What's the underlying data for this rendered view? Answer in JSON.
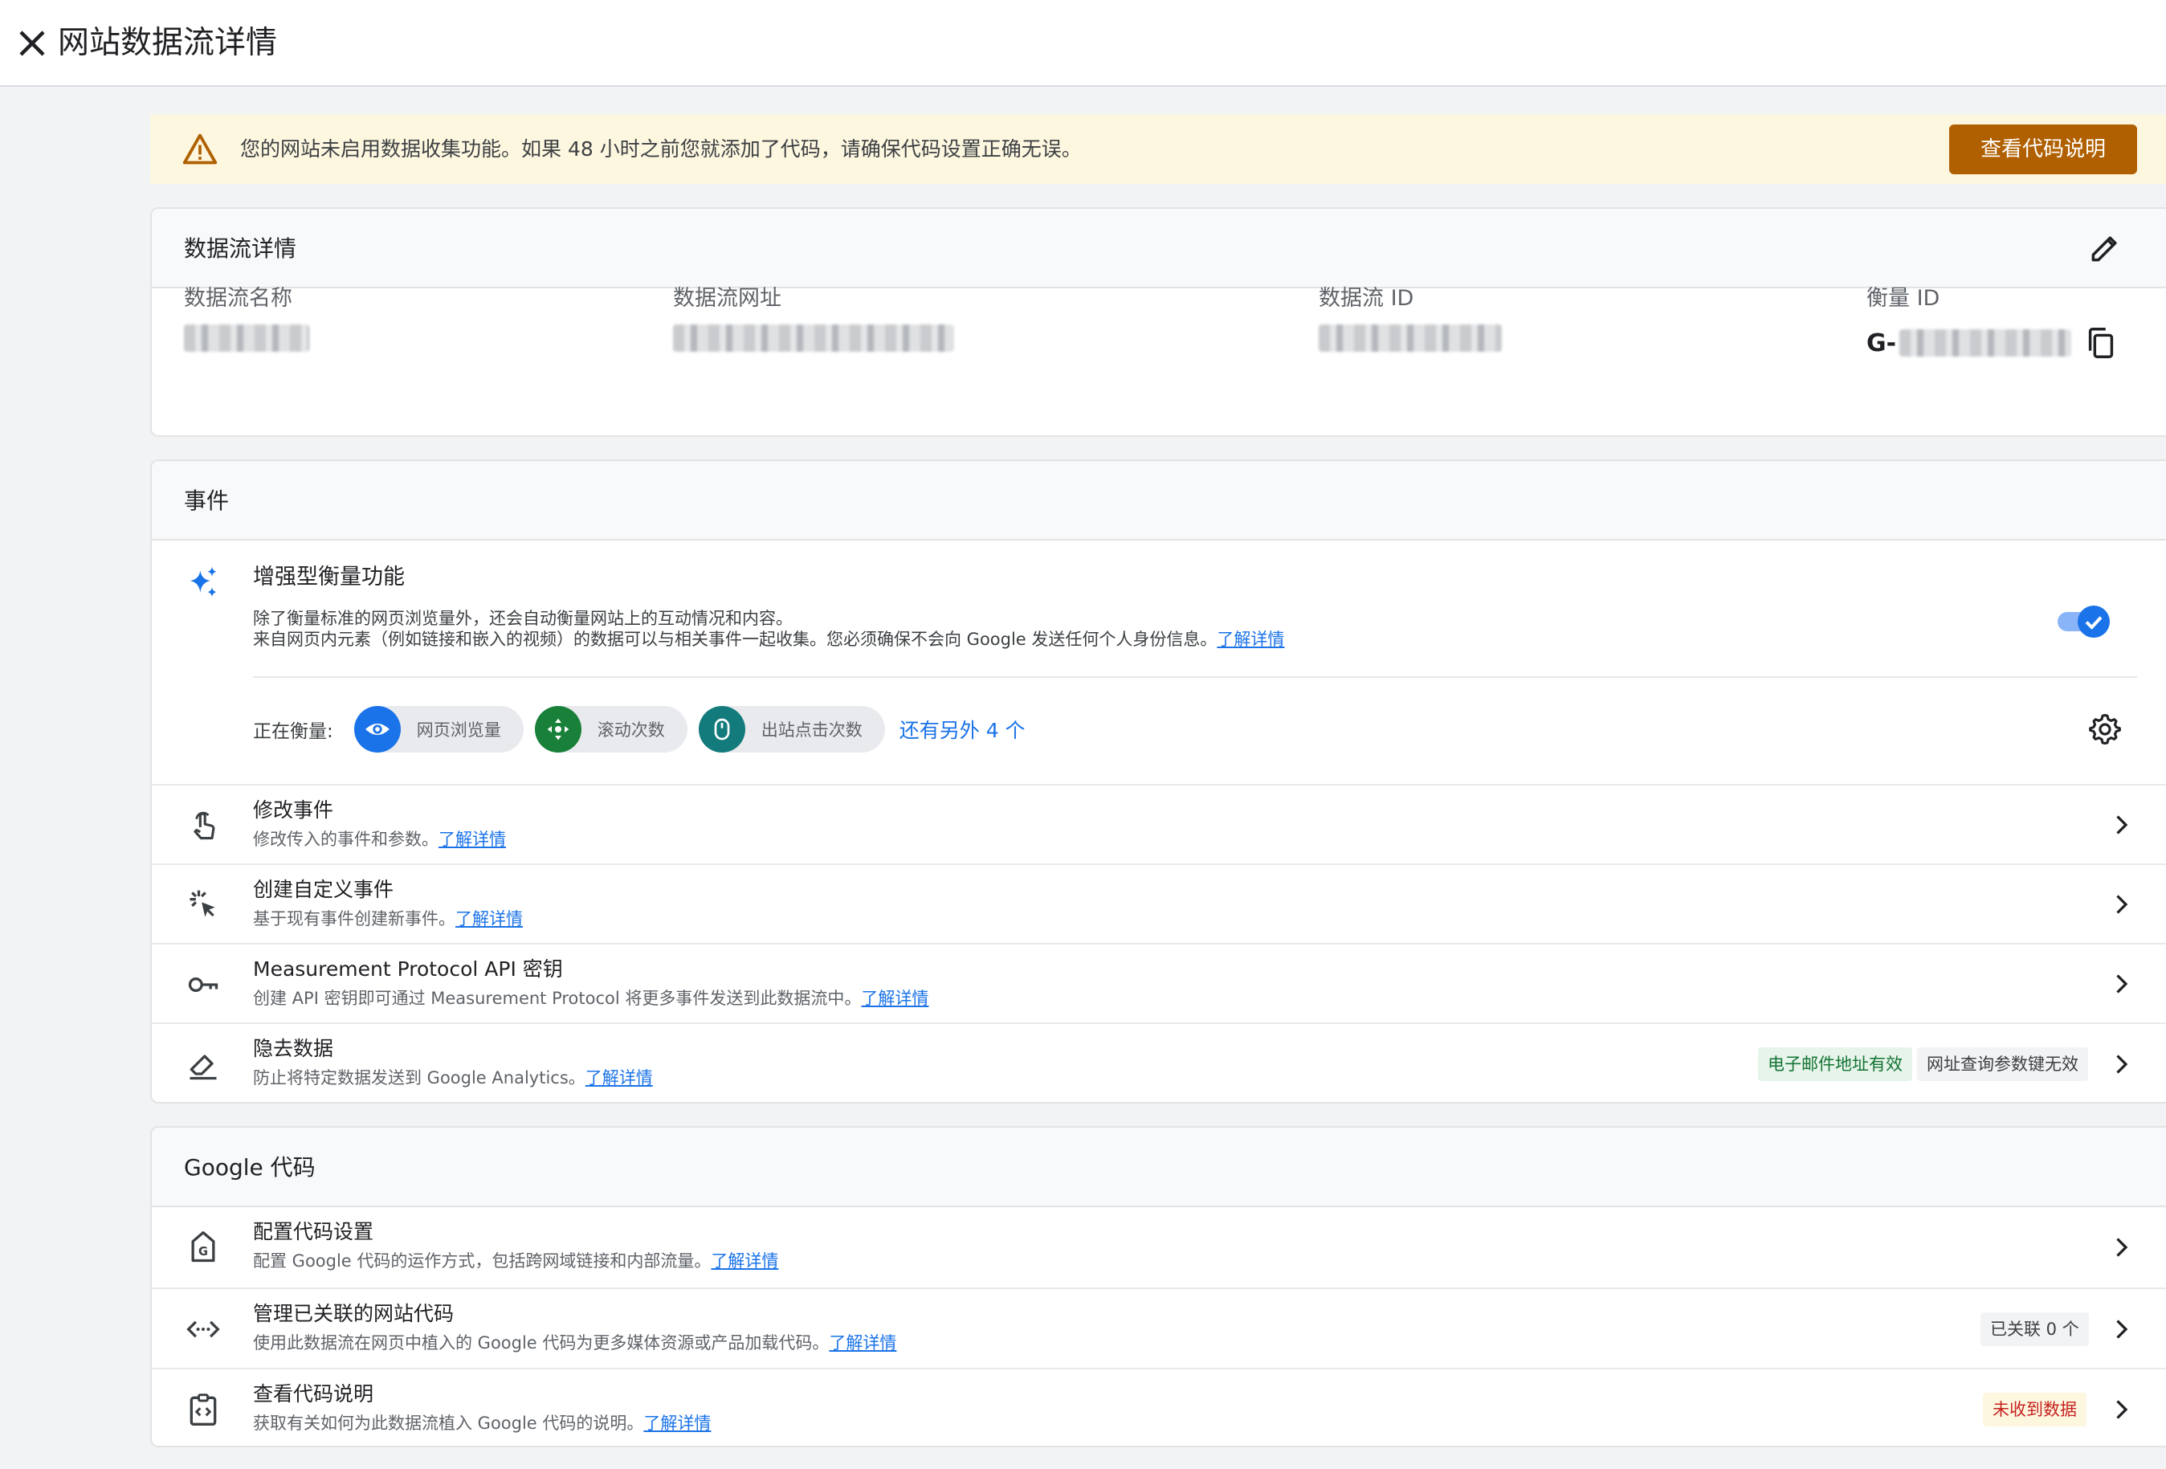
{
  "page": {
    "title": "网站数据流详情"
  },
  "banner": {
    "message": "您的网站未启用数据收集功能。如果 48 小时之前您就添加了代码，请确保代码设置正确无误。",
    "button_label": "查看代码说明"
  },
  "stream_details": {
    "title": "数据流详情",
    "fields": {
      "name_label": "数据流名称",
      "url_label": "数据流网址",
      "id_label": "数据流 ID",
      "measurement_label": "衡量 ID",
      "measurement_prefix": "G-"
    }
  },
  "events": {
    "title": "事件",
    "enhanced": {
      "title": "增强型衡量功能",
      "desc_line1": "除了衡量标准的网页浏览量外，还会自动衡量网站上的互动情况和内容。",
      "desc_line2": "来自网页内元素（例如链接和嵌入的视频）的数据可以与相关事件一起收集。您必须确保不会向 Google 发送任何个人身份信息。",
      "learn_more": "了解详情",
      "enabled": true,
      "measuring_label": "正在衡量:",
      "chips": [
        {
          "label": "网页浏览量",
          "icon": "eye-icon",
          "color": "#1a73e8"
        },
        {
          "label": "滚动次数",
          "icon": "scroll-icon",
          "color": "#188038"
        },
        {
          "label": "出站点击次数",
          "icon": "mouse-icon",
          "color": "#137b7c"
        }
      ],
      "more_link": "还有另外 4 个"
    },
    "rows": [
      {
        "title": "修改事件",
        "desc": "修改传入的事件和参数。",
        "link": "了解详情",
        "icon": "touch-icon"
      },
      {
        "title": "创建自定义事件",
        "desc": "基于现有事件创建新事件。",
        "link": "了解详情",
        "icon": "click-sparkle-icon"
      },
      {
        "title": "Measurement Protocol API 密钥",
        "desc": "创建 API 密钥即可通过 Measurement Protocol 将更多事件发送到此数据流中。",
        "link": "了解详情",
        "icon": "key-icon"
      },
      {
        "title": "隐去数据",
        "desc": "防止将特定数据发送到 Google Analytics。",
        "link": "了解详情",
        "icon": "eraser-icon",
        "badges": [
          "电子邮件地址有效",
          "网址查询参数键无效"
        ]
      }
    ]
  },
  "google_tag": {
    "title": "Google 代码",
    "rows": [
      {
        "title": "配置代码设置",
        "desc": "配置 Google 代码的运作方式，包括跨网域链接和内部流量。",
        "link": "了解详情",
        "icon": "tag-icon"
      },
      {
        "title": "管理已关联的网站代码",
        "desc": "使用此数据流在网页中植入的 Google 代码为更多媒体资源或产品加载代码。",
        "link": "了解详情",
        "icon": "code-icon",
        "badge": "已关联 0 个"
      },
      {
        "title": "查看代码说明",
        "desc": "获取有关如何为此数据流植入 Google 代码的说明。",
        "link": "了解详情",
        "icon": "clipboard-code-icon",
        "badge": "未收到数据"
      }
    ]
  },
  "colors": {
    "accent": "#1a73e8",
    "warning_button": "#b06000",
    "banner_bg": "#fef7e0"
  }
}
